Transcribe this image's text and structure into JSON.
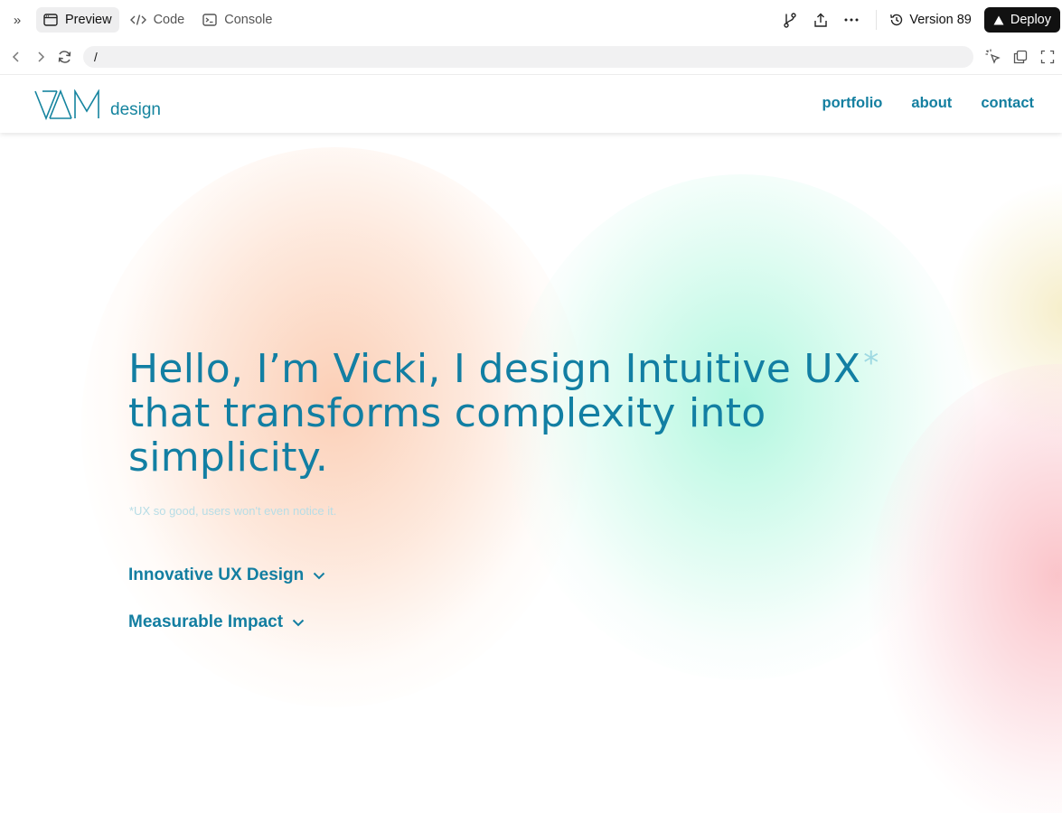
{
  "toolbar": {
    "tabs": [
      {
        "label": "Preview",
        "icon": "browser-window-icon",
        "active": true
      },
      {
        "label": "Code",
        "icon": "code-brackets-icon",
        "active": false
      },
      {
        "label": "Console",
        "icon": "terminal-icon",
        "active": false
      }
    ],
    "version_label": "Version 89",
    "deploy_label": "Deploy"
  },
  "address_bar": {
    "url": "/"
  },
  "site": {
    "logo_text": "design",
    "nav": [
      "portfolio",
      "about",
      "contact"
    ],
    "hero": {
      "line1": "Hello, I’m Vicki, I design Intuitive UX",
      "asterisk": "*",
      "line2": "that transforms complexity into",
      "line3": "simplicity."
    },
    "footnote": "*UX so good, users won't even notice it.",
    "expanders": [
      "Innovative UX Design",
      "Measurable Impact"
    ]
  },
  "colors": {
    "brand_teal": "#127fa3",
    "asterisk": "#9ed9e2",
    "deploy_bg": "#111111"
  }
}
